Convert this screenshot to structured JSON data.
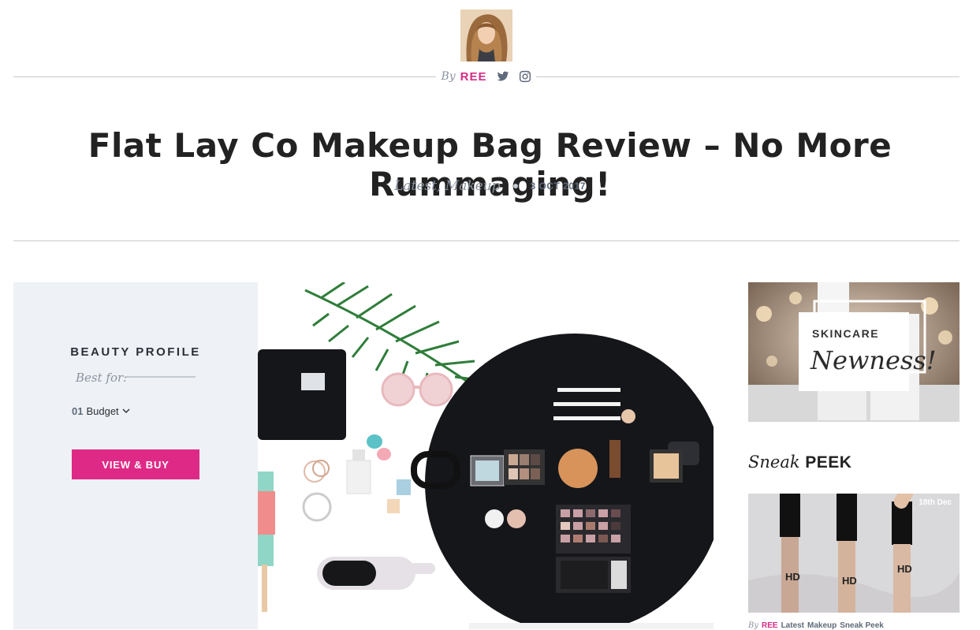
{
  "author": {
    "by_label": "By",
    "name": "REE",
    "twitter_icon": "twitter-icon",
    "instagram_icon": "instagram-icon"
  },
  "post": {
    "title": "Flat Lay Co Makeup Bag Review – No More Rummaging!",
    "categories": [
      "Latest",
      "Makeup"
    ],
    "category_separator": ",",
    "date": "3 OCT 2017"
  },
  "beauty_profile": {
    "title": "BEAUTY PROFILE",
    "best_for_label": "Best for:",
    "item_number": "01",
    "item_label": "Budget",
    "button_label": "VIEW & BUY"
  },
  "ad": {
    "line1": "SKINCARE",
    "line2": "Newness!"
  },
  "sneak_peek": {
    "title_italic": "Sneak",
    "title_bold": "PEEK",
    "date": "18th Dec",
    "by_label": "By",
    "author": "REE",
    "categories": [
      "Latest",
      "Makeup",
      "Sneak Peek"
    ]
  },
  "colors": {
    "accent": "#de2a86",
    "author_pink": "#d42c85",
    "muted_text": "#8a93a0",
    "panel_bg": "#eef1f5"
  }
}
